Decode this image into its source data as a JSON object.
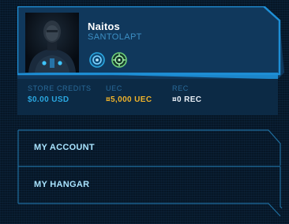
{
  "profile": {
    "username": "Naitos",
    "handle": "SANTOLAPT",
    "badges": [
      {
        "icon": "target-badge-icon",
        "color": "#2aa7e0"
      },
      {
        "icon": "crosshair-badge-icon",
        "color": "#6ccf7a"
      }
    ]
  },
  "stats": [
    {
      "label": "STORE CREDITS",
      "value": "$0.00 USD",
      "color": "#2aa7e0"
    },
    {
      "label": "UEC",
      "value": "¤5,000 UEC",
      "color": "#f0b32a"
    },
    {
      "label": "REC",
      "value": "¤0 REC",
      "color": "#e8eef5"
    }
  ],
  "menu": {
    "items": [
      {
        "label": "MY ACCOUNT"
      },
      {
        "label": "MY HANGAR"
      }
    ]
  },
  "colors": {
    "accent": "#1e8fd6",
    "card_dark": "#0d2a44",
    "card_light": "#11385a"
  }
}
